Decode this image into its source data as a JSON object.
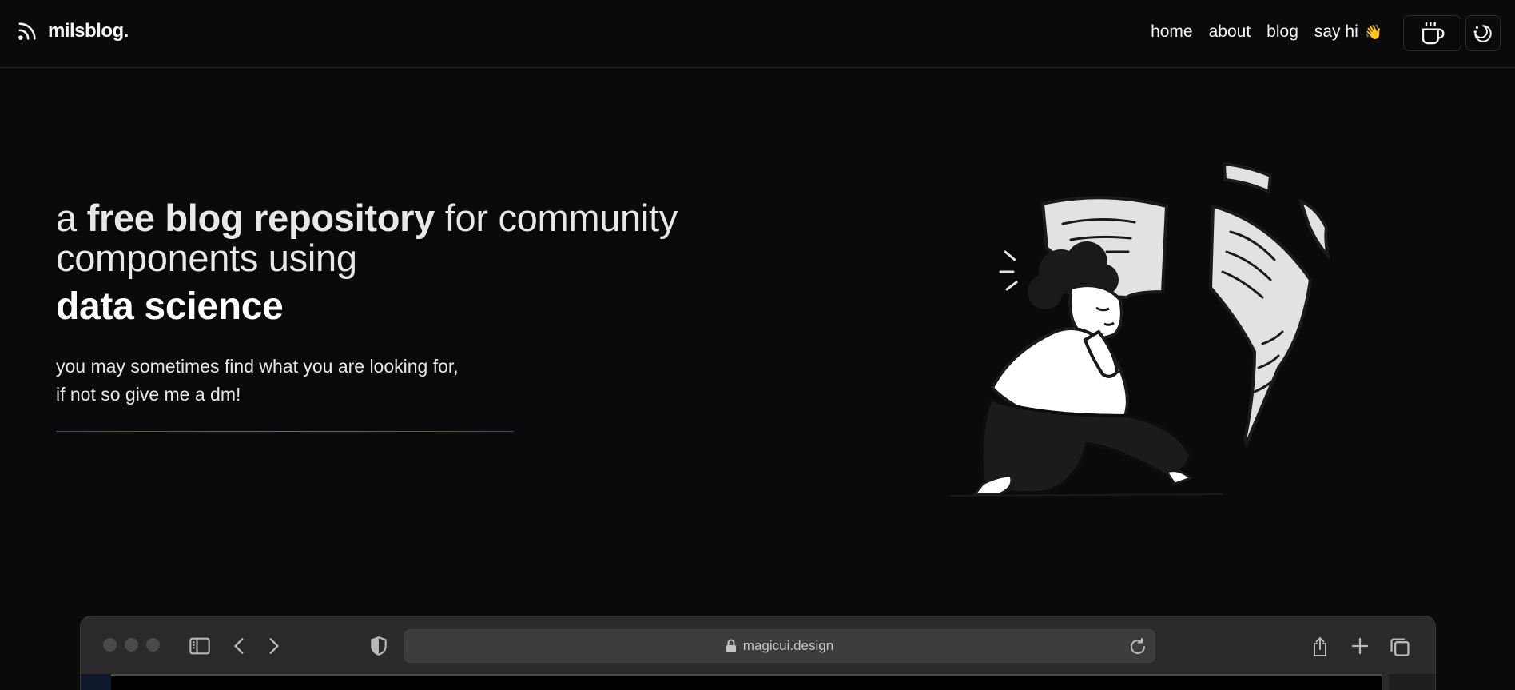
{
  "brand": {
    "name": "milsblog."
  },
  "nav": {
    "home": "home",
    "about": "about",
    "blog": "blog",
    "say_hi": "say hi",
    "wave": "👋"
  },
  "hero": {
    "title_pre": "a ",
    "title_bold": "free blog repository",
    "title_post": " for community components using",
    "subtitle": "data science",
    "desc_line1": "you may sometimes find what you are looking for,",
    "desc_line2": "if not so give me a dm!"
  },
  "browser": {
    "url": "magicui.design"
  },
  "icons": {
    "rss": "rss-icon",
    "coffee": "coffee-cup-icon",
    "theme": "moon-theme-icon",
    "sidebar": "sidebar-icon",
    "back": "chevron-left-icon",
    "forward": "chevron-right-icon",
    "shield": "shield-icon",
    "lock": "lock-icon",
    "reload": "reload-icon",
    "share": "share-icon",
    "new_tab": "plus-icon",
    "tabs": "tabs-overview-icon"
  },
  "colors": {
    "background": "#0a0a0c",
    "text": "#e8e8ea",
    "divider": "#5b6f92",
    "browser_chrome": "#2a2a2c"
  }
}
